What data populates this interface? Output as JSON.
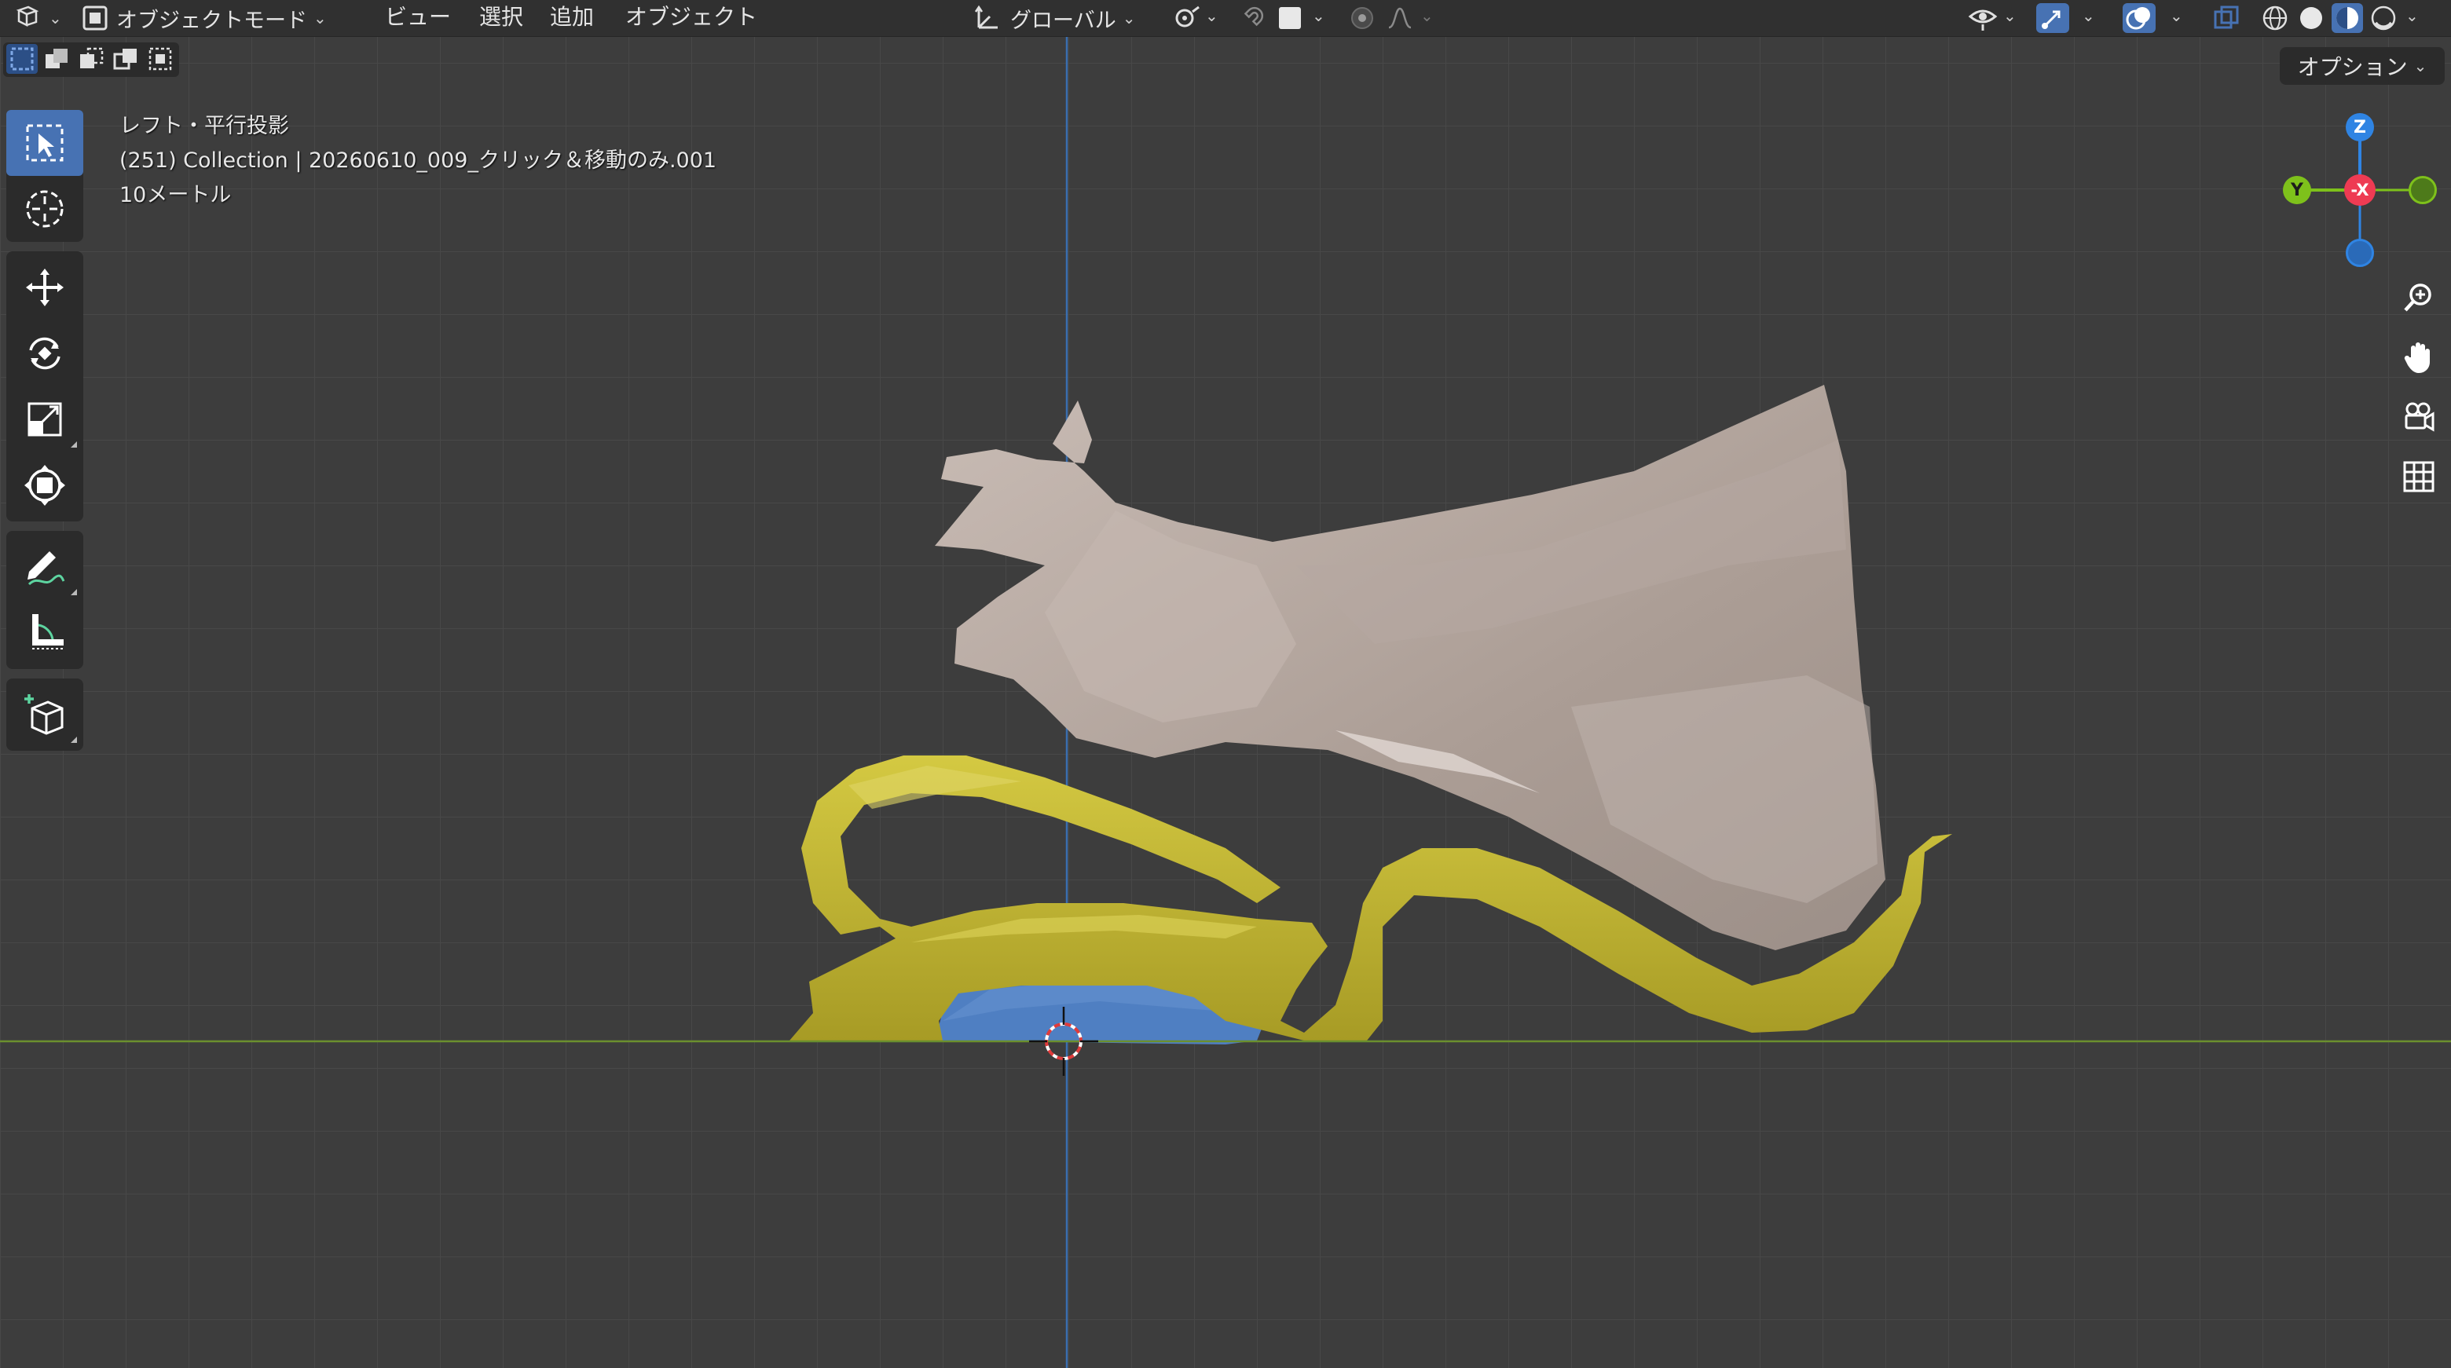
{
  "header": {
    "mode_label": "オブジェクトモード",
    "menus": [
      "ビュー",
      "選択",
      "追加",
      "オブジェクト"
    ],
    "transform_orientation": "グローバル"
  },
  "options_label": "オプション",
  "viewport": {
    "view_name": "レフト・平行投影",
    "collection_info": "(251) Collection | 20260610_009_クリック＆移動のみ.001",
    "scale_info": "10メートル"
  },
  "gizmo": {
    "z_label": "Z",
    "y_label": "Y",
    "x_label": "-X"
  },
  "colors": {
    "accent": "#4772b3",
    "x_axis": "#ee3b53",
    "y_axis": "#7ec11b",
    "z_axis": "#2f84e3",
    "ground_line": "#6b8f2e",
    "vertical_line": "#3a6fb0",
    "yellow_model": "#c2b634",
    "hand_model": "#b8aba3",
    "blue_model": "#4f7fc2"
  },
  "icons": {
    "editor_type": "view3d-icon",
    "tools": [
      "select-box-icon",
      "cursor-icon",
      "move-icon",
      "rotate-icon",
      "scale-icon",
      "transform-icon",
      "annotate-icon",
      "measure-icon",
      "add-cube-icon"
    ],
    "nav": [
      "zoom-icon",
      "hand-pan-icon",
      "camera-icon",
      "grid-icon"
    ]
  }
}
